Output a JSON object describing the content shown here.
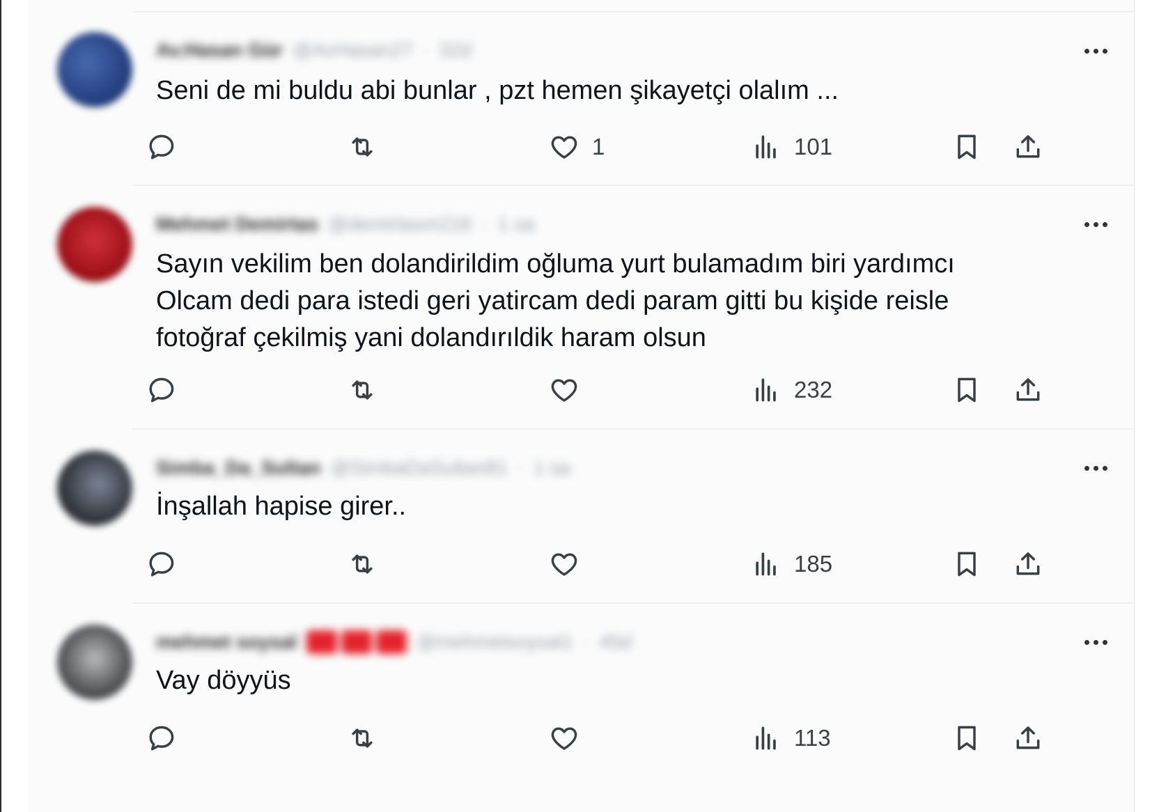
{
  "tweets": [
    {
      "name": "Av.Hasan Gür",
      "handle": "@AvHasan27",
      "time": "32d",
      "text": "Seni de mi buldu abi bunlar , pzt hemen şikayetçi olalım ...",
      "likes": "1",
      "views": "101",
      "avatar_color": "#2d4e93"
    },
    {
      "name": "Mehmet Demirtas",
      "handle": "@demirtasm216",
      "time": "1 sa",
      "text": "Sayın vekilim ben dolandirildim oğluma yurt bulamadım biri yardımcı Olcam dedi para istedi geri yatircam dedi param gitti bu kişide reisle fotoğraf çekilmiş yani dolandırıldik haram olsun",
      "likes": "",
      "views": "232",
      "avatar_color": "#a8141c"
    },
    {
      "name": "Simba_Da_Sultan",
      "handle": "@SimbaDaSultan81",
      "time": "1 sa",
      "text": "İnşallah hapise girer..",
      "likes": "",
      "views": "185",
      "avatar_color": "#2e3136"
    },
    {
      "name": "mehmet soysal",
      "handle": "@mehmetsoysal1",
      "time": "45d",
      "text": "Vay döyyüs",
      "likes": "",
      "views": "113",
      "avatar_color": "#55585c"
    }
  ],
  "icons": {
    "reply": "reply-icon",
    "retweet": "retweet-icon",
    "like": "heart-icon",
    "views": "views-icon",
    "bookmark": "bookmark-icon",
    "share": "share-icon",
    "more": "more-icon"
  },
  "colors": {
    "text": "#0f1419",
    "muted": "#536471",
    "badge": "#e3232c"
  }
}
